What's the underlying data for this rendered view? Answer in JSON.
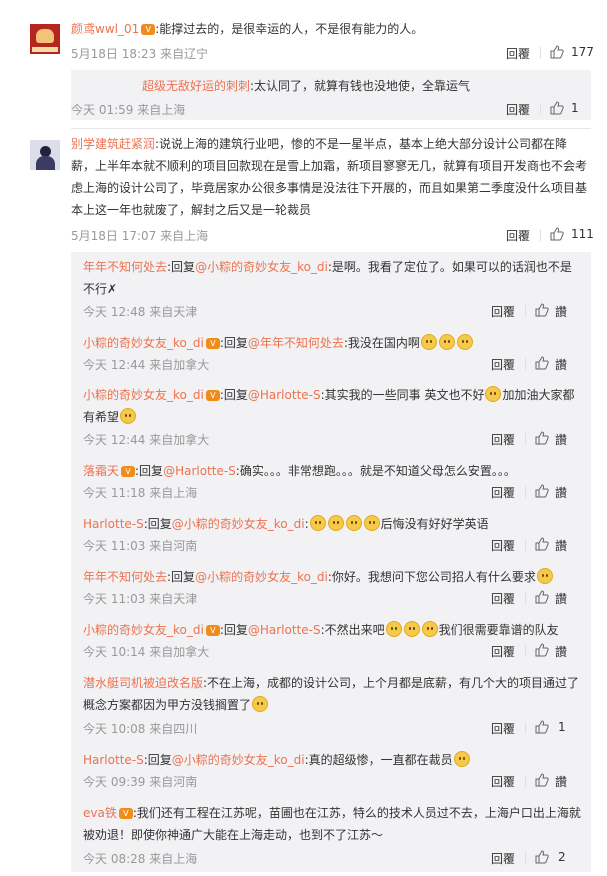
{
  "comments": [
    {
      "user": "颜鸢wwl_01",
      "content": ":能撑过去的，是很幸运的人，不是很有能力的人。",
      "meta": "5月18日 18:23 来自辽宁",
      "reply_label": "回覆",
      "likes": "177",
      "replies": [
        {
          "user": "超级无敌好运的刺刺",
          "content": ":太认同了，就算有钱也没地使，全靠运气",
          "meta": "今天 01:59 来自上海",
          "reply_label": "回覆",
          "likes": "1"
        }
      ]
    },
    {
      "user": "别学建筑赶紧润",
      "content": ":说说上海的建筑行业吧，惨的不是一星半点，基本上绝大部分设计公司都在降薪，上半年本就不顺利的项目回款现在是雪上加霜，新项目寥寥无几，就算有项目开发商也不会考虑上海的设计公司了，毕竟居家办公很多事情是没法往下开展的，而且如果第二季度没什么项目基本上这一年也就废了，解封之后又是一轮裁员",
      "meta": "5月18日 17:07 来自上海",
      "reply_label": "回覆",
      "likes": "111",
      "replies": [
        {
          "user": "年年不知何处去",
          "reply_word": ":回复",
          "mention": "@小粽的奇妙女友_ko_di",
          "content": ":是啊。我看了定位了。如果可以的话润也不是不行✗",
          "meta": "今天 12:48 来自天津",
          "reply_label": "回覆",
          "likes": "讚"
        },
        {
          "user": "小粽的奇妙女友_ko_di",
          "reply_word": ":回复",
          "mention": "@年年不知何处去",
          "content": ":我没在国内啊",
          "meta": "今天 12:44 来自加拿大",
          "reply_label": "回覆",
          "likes": "讚"
        },
        {
          "user": "小粽的奇妙女友_ko_di",
          "reply_word": ":回复",
          "mention": "@Harlotte-S",
          "content": ":其实我的一些同事 英文也不好",
          "content2": "加加油大家都有希望",
          "meta": "今天 12:44 来自加拿大",
          "reply_label": "回覆",
          "likes": "讚"
        },
        {
          "user": "落霜天",
          "reply_word": ":回复",
          "mention": "@Harlotte-S",
          "content": ":确实。。。非常想跑。。。就是不知道父母怎么安置。。。",
          "meta": "今天 11:18 来自上海",
          "reply_label": "回覆",
          "likes": "讚"
        },
        {
          "user": "Harlotte-S",
          "reply_word": ":回复",
          "mention": "@小粽的奇妙女友_ko_di",
          "content": ":",
          "content2": "后悔没有好好学英语",
          "meta": "今天 11:03 来自河南",
          "reply_label": "回覆",
          "likes": "讚"
        },
        {
          "user": "年年不知何处去",
          "reply_word": ":回复",
          "mention": "@小粽的奇妙女友_ko_di",
          "content": ":你好。我想问下您公司招人有什么要求",
          "meta": "今天 11:03 来自天津",
          "reply_label": "回覆",
          "likes": "讚"
        },
        {
          "user": "小粽的奇妙女友_ko_di",
          "reply_word": ":回复",
          "mention": "@Harlotte-S",
          "content": ":不然出来吧",
          "content2": "我们很需要靠谱的队友",
          "meta": "今天 10:14 来自加拿大",
          "reply_label": "回覆",
          "likes": "讚"
        },
        {
          "user": "潜水艇司机被迫改名版",
          "content": ":不在上海，成都的设计公司，上个月都是底薪，有几个大的项目通过了概念方案都因为甲方没钱搁置了",
          "meta": "今天 10:08 来自四川",
          "reply_label": "回覆",
          "likes": "1"
        },
        {
          "user": "Harlotte-S",
          "reply_word": ":回复",
          "mention": "@小粽的奇妙女友_ko_di",
          "content": ":真的超级惨，一直都在裁员",
          "meta": "今天 09:39 来自河南",
          "reply_label": "回覆",
          "likes": "讚"
        },
        {
          "user": "eva铁",
          "content": ":我们还有工程在江苏呢，苗圃也在江苏，特么的技术人员过不去，上海户口出上海就被劝退！即使你神通广大能在上海走动，也到不了江苏～",
          "meta": "今天 08:28 来自上海",
          "reply_label": "回覆",
          "likes": "2"
        }
      ]
    }
  ],
  "colors": {
    "username": "#eb7350",
    "mention": "#eb7350",
    "meta": "#999999",
    "reply_bg": "#f2f2f5",
    "badge": "#f08c1a",
    "emoji": "#f7c948"
  },
  "icons": [
    "thumb-up-icon",
    "vip-badge-icon",
    "emoji-icon"
  ]
}
